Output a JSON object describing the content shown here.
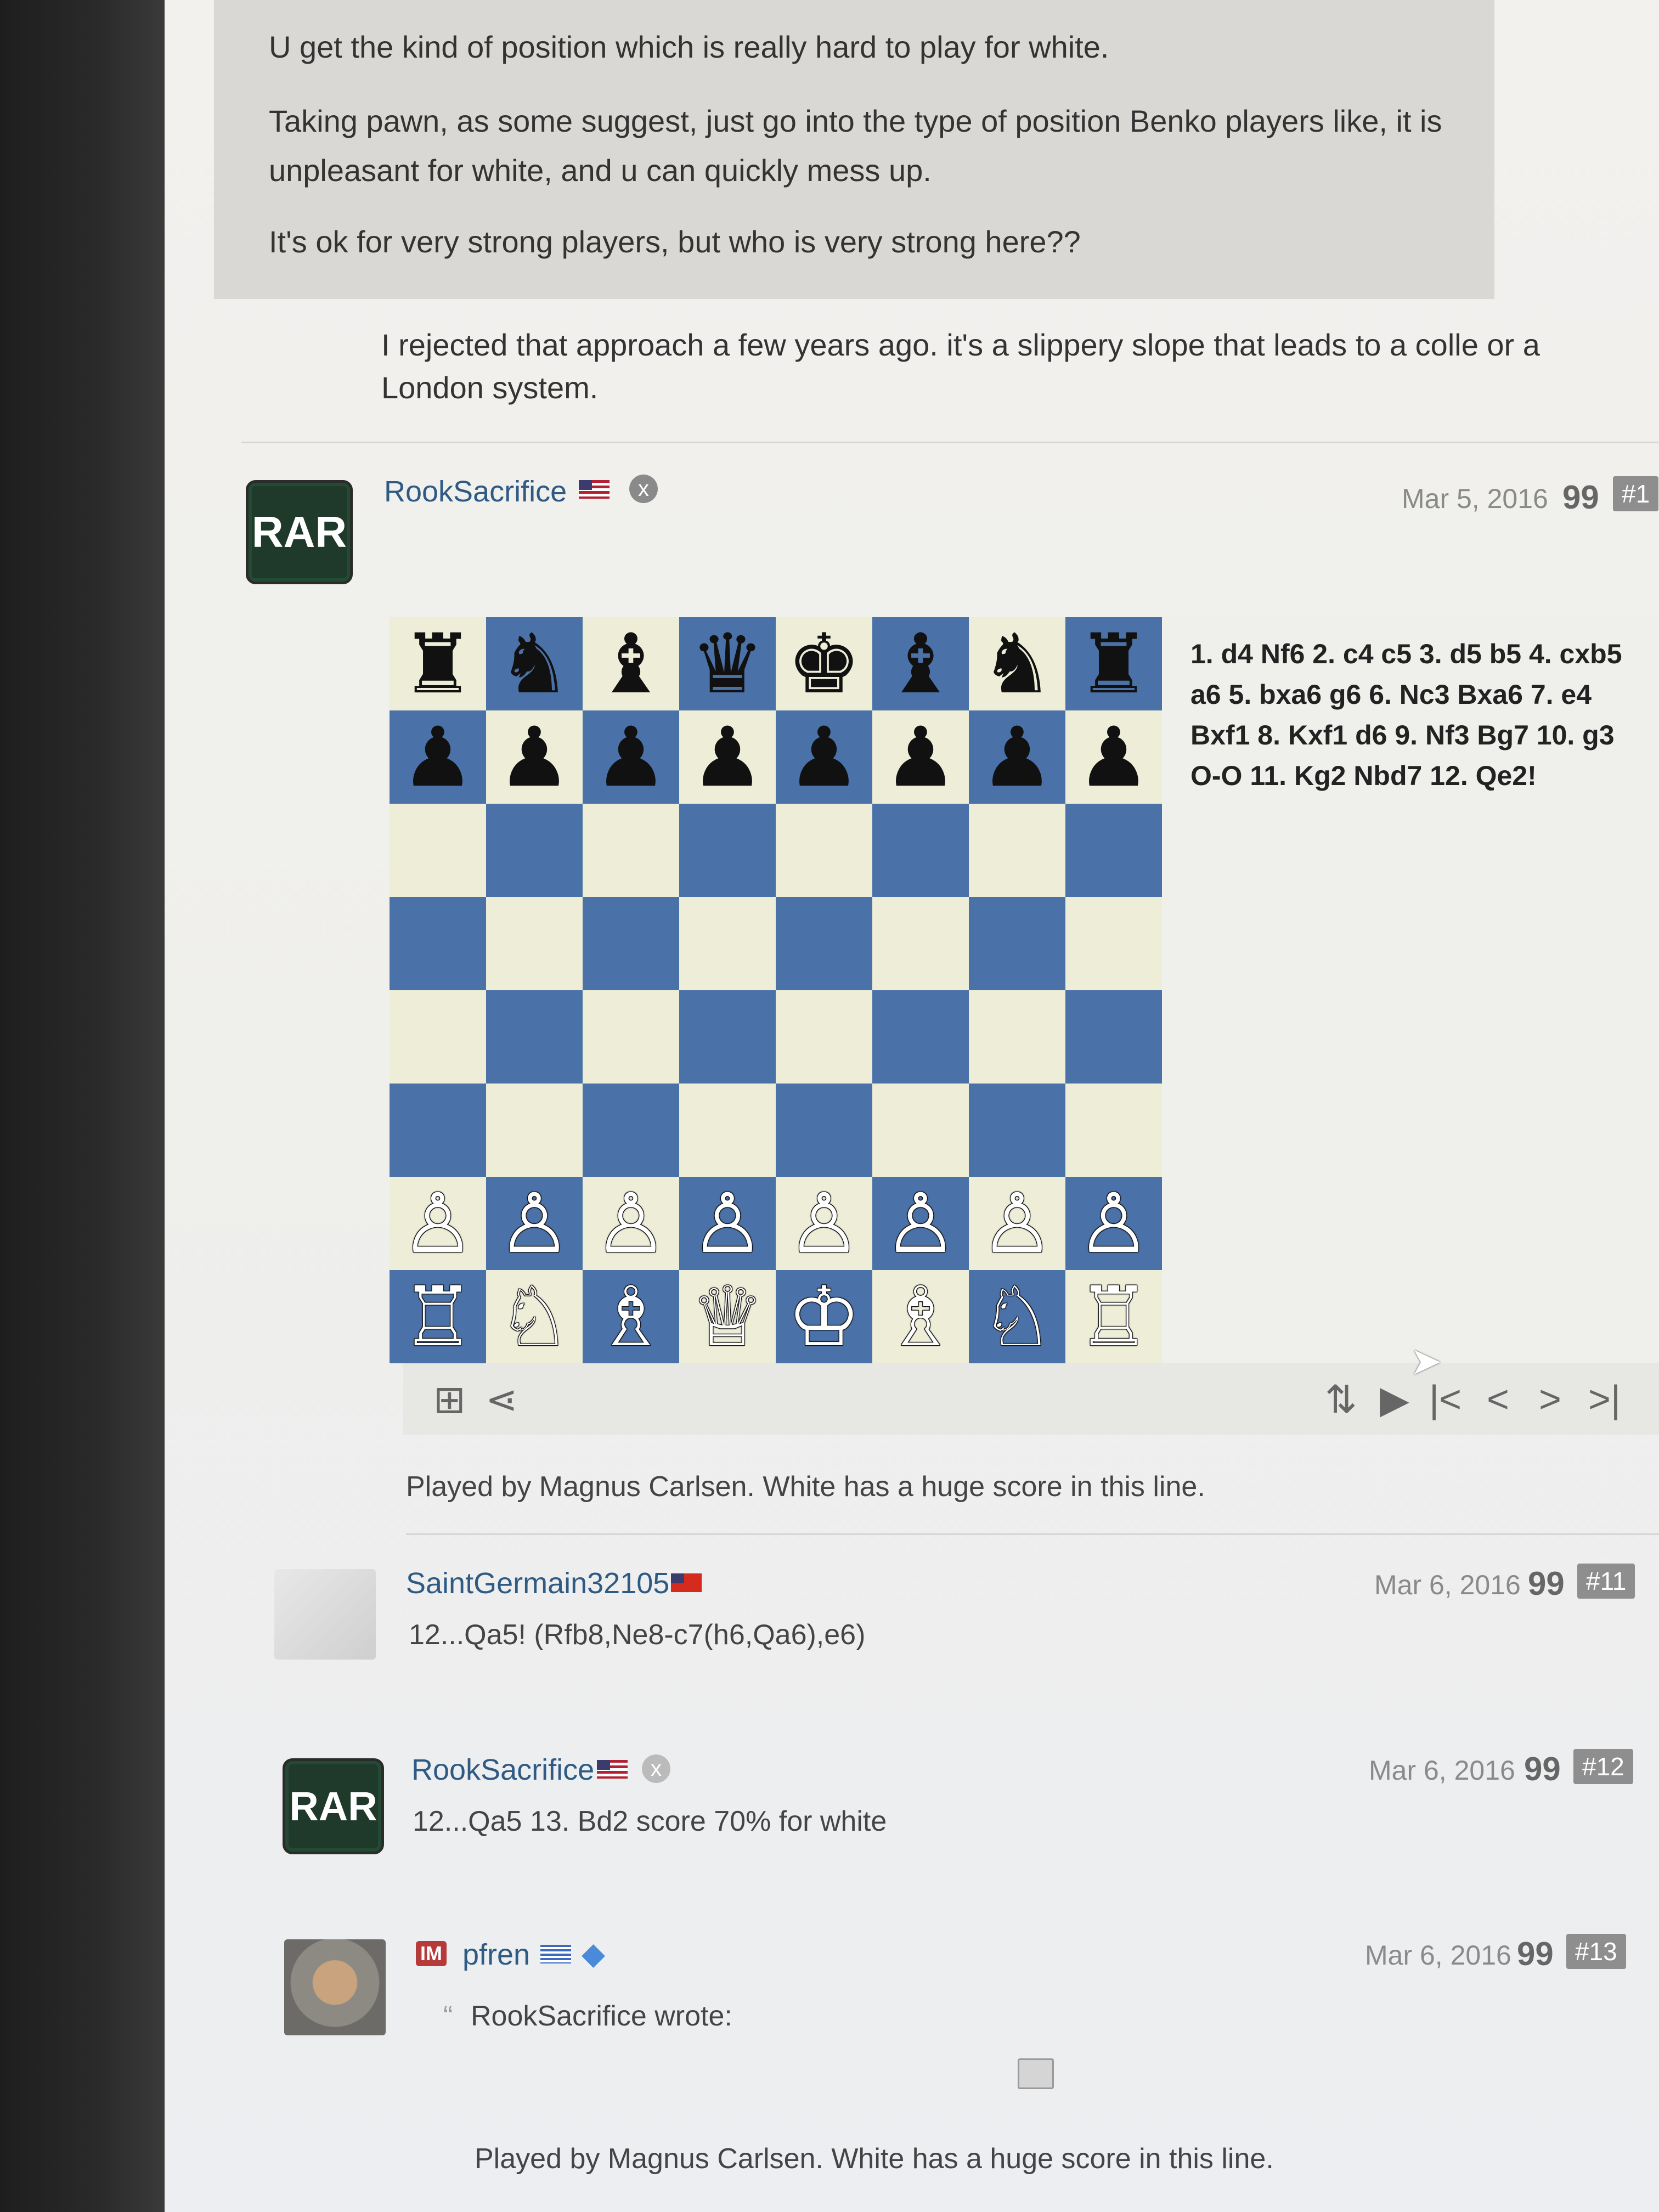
{
  "quote_block": {
    "line1": "U get the kind of position which is really hard to play for white.",
    "line2a": "Taking pawn, as some suggest, just go into the type of position Benko players like, it is",
    "line2b": "unpleasant for white, and u can quickly mess up.",
    "line3": "It's ok for very strong players, but who is very strong here??"
  },
  "reply_text": "I rejected that approach a few years ago. it's a slippery slope that leads to a colle or a London system.",
  "posts": [
    {
      "avatar_text": "RAR",
      "username": "RookSacrifice",
      "date": "Mar 5, 2016",
      "number": "#1",
      "moves": "1. d4 Nf6 2. c4 c5 3. d5 b5 4. cxb5 a6 5. bxa6 g6 6. Nc3 Bxa6 7. e4 Bxf1 8. Kxf1 d6 9. Nf3 Bg7 10. g3 O-O 11. Kg2 Nbd7 12. Qe2!",
      "body": "Played by Magnus Carlsen. White has a huge score in this line."
    },
    {
      "username": "SaintGermain32105",
      "date": "Mar 6, 2016",
      "number": "#11",
      "body": "12...Qa5! (Rfb8,Ne8-c7(h6,Qa6),e6)"
    },
    {
      "avatar_text": "RAR",
      "username": "RookSacrifice",
      "date": "Mar 6, 2016",
      "number": "#12",
      "body": "12...Qa5 13. Bd2 score 70% for white"
    },
    {
      "badge": "IM",
      "username": "pfren",
      "date": "Mar 6, 2016",
      "number": "#13",
      "quote_header": "RookSacrifice wrote:",
      "quote_body": "Played by Magnus Carlsen. White has a huge score in this line."
    }
  ],
  "icons": {
    "quote": "99",
    "mod": "x",
    "controls": [
      "flip-icon",
      "play-icon",
      "first-icon",
      "prev-icon",
      "next-icon",
      "last-icon"
    ],
    "analysis": [
      "analysis-icon",
      "share-icon"
    ]
  },
  "board": {
    "rank8": [
      "♜",
      "♞",
      "♝",
      "♛",
      "♚",
      "♝",
      "♞",
      "♜"
    ],
    "rank7": [
      "♟",
      "♟",
      "♟",
      "♟",
      "♟",
      "♟",
      "♟",
      "♟"
    ],
    "rank2": [
      "♙",
      "♙",
      "♙",
      "♙",
      "♙",
      "♙",
      "♙",
      "♙"
    ],
    "rank1": [
      "♖",
      "♘",
      "♗",
      "♕",
      "♔",
      "♗",
      "♘",
      "♖"
    ]
  },
  "colors": {
    "light_square": "#eeeed8",
    "dark_square": "#4b72a8",
    "username": "#2f5a84",
    "post_number_bg": "#8e8e8e"
  }
}
